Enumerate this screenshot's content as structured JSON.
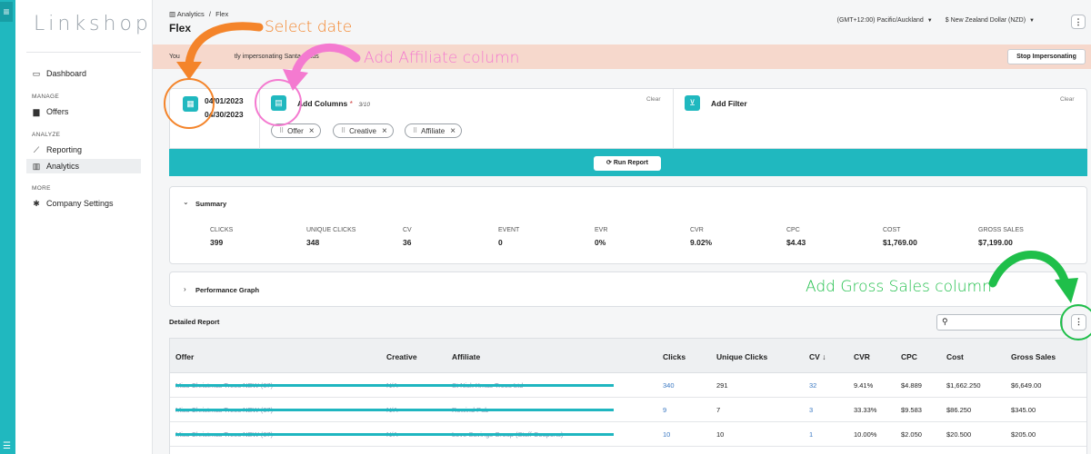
{
  "sidebar": {
    "logo": "Linkshop",
    "items": [
      {
        "label": "Dashboard",
        "icon": "monitor-icon"
      },
      {
        "label": "Offers",
        "icon": "folder-icon"
      },
      {
        "label": "Reporting",
        "icon": "trend-icon"
      },
      {
        "label": "Analytics",
        "icon": "bar-chart-icon"
      },
      {
        "label": "Company Settings",
        "icon": "gear-icon"
      }
    ],
    "sections": [
      "MANAGE",
      "ANALYZE",
      "MORE"
    ]
  },
  "header": {
    "breadcrumb_parent": "Analytics",
    "breadcrumb_sep": "/",
    "breadcrumb_current": "Flex",
    "title": "Flex",
    "timezone": "(GMT+12:00) Pacific/Auckland",
    "currency": "$ New Zealand Dollar (NZD)"
  },
  "banner": {
    "text_start": "You",
    "text_end": "tly impersonating Santa Claus",
    "stop_label": "Stop Impersonating"
  },
  "builder": {
    "date_start": "04/01/2023",
    "date_end": "04/30/2023",
    "add_columns_label": "Add Columns",
    "required_mark": "*",
    "columns_count": "3/10",
    "clear_label": "Clear",
    "add_filter_label": "Add Filter",
    "chips": [
      "Offer",
      "Creative",
      "Affiliate"
    ],
    "run_label": "Run Report"
  },
  "summary": {
    "title": "Summary",
    "metrics": [
      {
        "label": "CLICKS",
        "value": "399"
      },
      {
        "label": "UNIQUE CLICKS",
        "value": "348"
      },
      {
        "label": "CV",
        "value": "36"
      },
      {
        "label": "EVENT",
        "value": "0"
      },
      {
        "label": "EVR",
        "value": "0%"
      },
      {
        "label": "CVR",
        "value": "9.02%"
      },
      {
        "label": "CPC",
        "value": "$4.43"
      },
      {
        "label": "COST",
        "value": "$1,769.00"
      },
      {
        "label": "GROSS SALES",
        "value": "$7,199.00"
      }
    ]
  },
  "perf_graph": {
    "title": "Performance Graph"
  },
  "detailed_report": {
    "title": "Detailed Report",
    "columns": [
      "Offer",
      "Creative",
      "Affiliate",
      "Clicks",
      "Unique Clicks",
      "CV",
      "CVR",
      "CPC",
      "Cost",
      "Gross Sales"
    ],
    "cv_sort_icon": "↓",
    "rows": [
      {
        "offer": "Miss Christmas Trees NEW (67)",
        "creative": "N/A",
        "affiliate": "St Nick Xmas Trees Ltd",
        "clicks": "340",
        "unique": "291",
        "cv": "32",
        "cvr": "9.41%",
        "cpc": "$4.889",
        "cost": "$1,662.250",
        "gross": "$6,649.00"
      },
      {
        "offer": "Miss Christmas Trees NEW (67)",
        "creative": "N/A",
        "affiliate": "Rewind Pub",
        "clicks": "9",
        "unique": "7",
        "cv": "3",
        "cvr": "33.33%",
        "cpc": "$9.583",
        "cost": "$86.250",
        "gross": "$345.00"
      },
      {
        "offer": "Miss Christmas Trees NEW (67)",
        "creative": "N/A",
        "affiliate": "Love Savings Group (Stuff Coupons)",
        "clicks": "10",
        "unique": "10",
        "cv": "1",
        "cvr": "10.00%",
        "cpc": "$2.050",
        "cost": "$20.500",
        "gross": "$205.00"
      }
    ]
  },
  "annotations": {
    "select_date": "Select date",
    "add_affiliate": "Add Affiliate column",
    "add_gross": "Add Gross Sales column",
    "colors": {
      "orange": "#f4842a",
      "pink": "#f47ad0",
      "green": "#1fbf4a"
    }
  },
  "colors": {
    "accent": "#20b8bf",
    "banner": "#f6d8cc",
    "link": "#3a78c2"
  }
}
